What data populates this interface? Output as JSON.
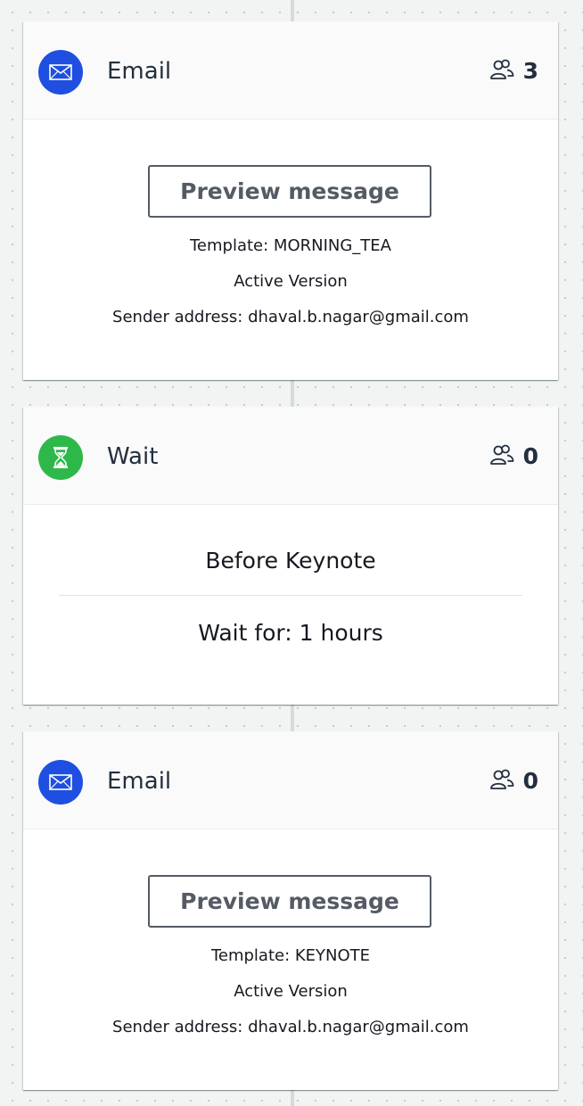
{
  "activities": [
    {
      "type": "email",
      "icon": "envelope-icon",
      "title": "Email",
      "participants": "3",
      "preview_label": "Preview message",
      "template": "Template: MORNING_TEA",
      "version": "Active Version",
      "sender": "Sender address: dhaval.b.nagar@gmail.com"
    },
    {
      "type": "wait",
      "icon": "hourglass-icon",
      "title": "Wait",
      "participants": "0",
      "name": "Before Keynote",
      "duration": "Wait for: 1 hours"
    },
    {
      "type": "email",
      "icon": "envelope-icon",
      "title": "Email",
      "participants": "0",
      "preview_label": "Preview message",
      "template": "Template: KEYNOTE",
      "version": "Active Version",
      "sender": "Sender address: dhaval.b.nagar@gmail.com"
    }
  ],
  "colors": {
    "email_icon_bg": "#1f4fe0",
    "wait_icon_bg": "#2fb84a",
    "canvas_bg": "#f2f3f3",
    "button_border": "#545b64"
  }
}
